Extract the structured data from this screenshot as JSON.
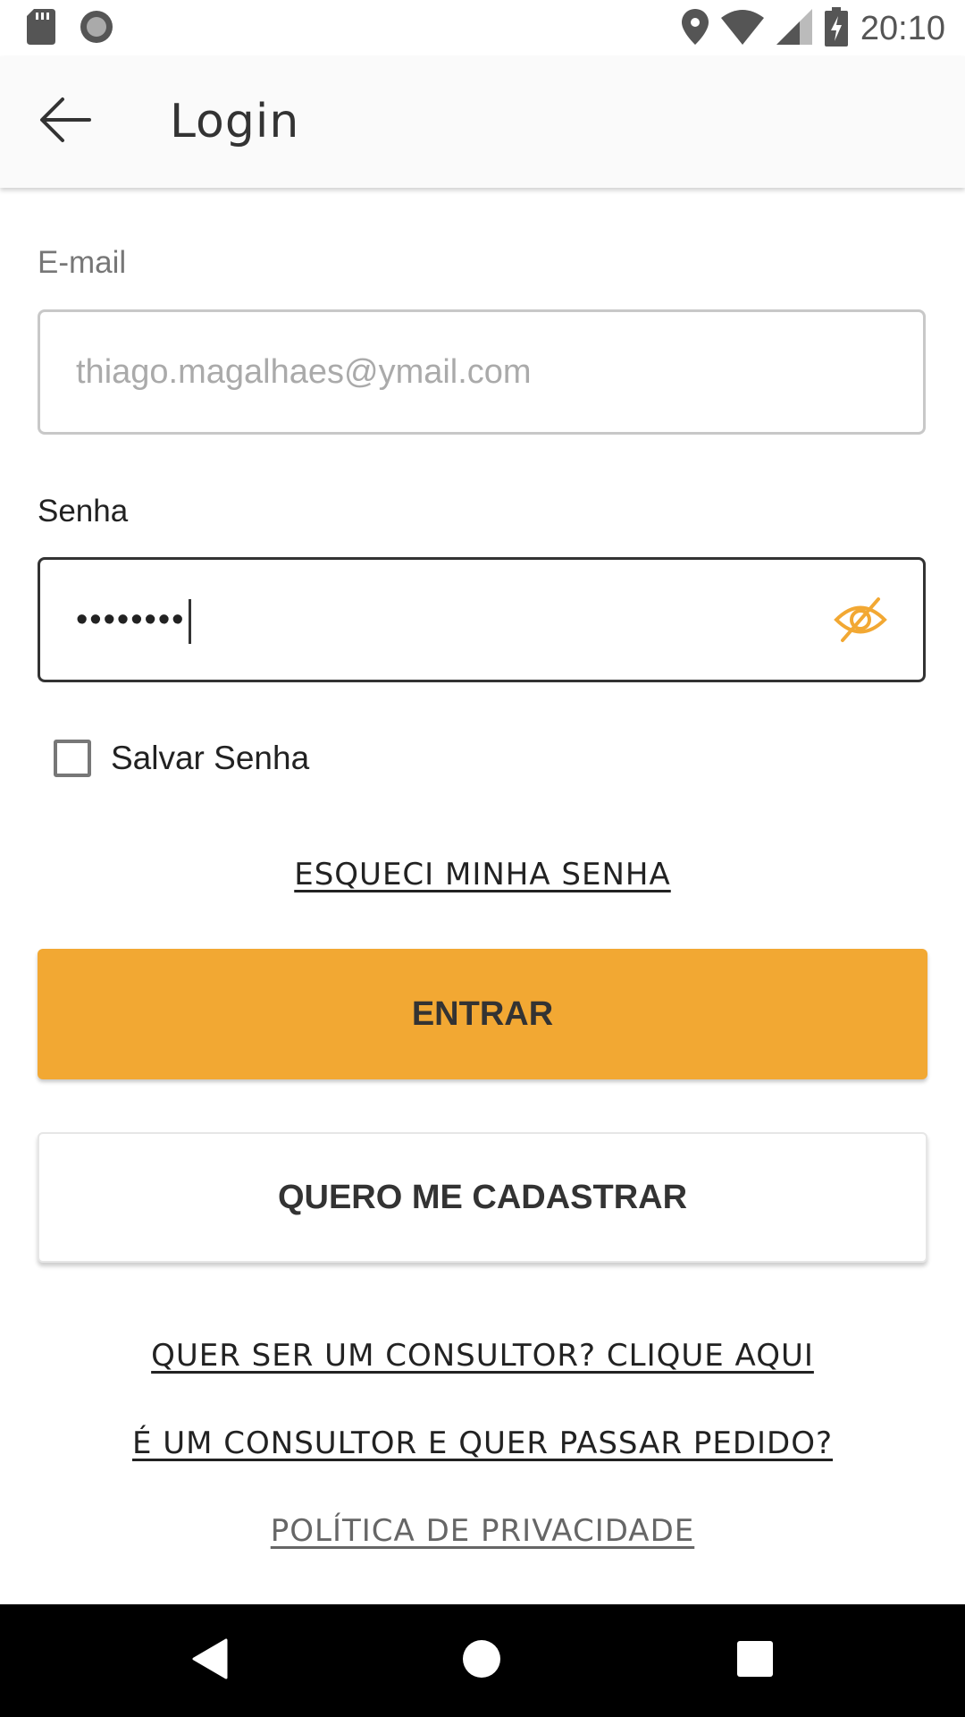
{
  "status_bar": {
    "time": "20:10",
    "icons": [
      "sd-card-icon",
      "sync-icon",
      "location-icon",
      "wifi-icon",
      "signal-icon",
      "battery-charging-icon"
    ]
  },
  "app_bar": {
    "title": "Login"
  },
  "form": {
    "email_label": "E-mail",
    "email_placeholder": "thiago.magalhaes@ymail.com",
    "password_label": "Senha",
    "password_value": "••••••••",
    "save_password_label": "Salvar Senha",
    "save_password_checked": false
  },
  "links": {
    "forgot_password": "ESQUECI MINHA SENHA",
    "become_consultant": "QUER SER UM CONSULTOR? CLIQUE AQUI",
    "consultant_order": "É UM CONSULTOR E QUER PASSAR PEDIDO?",
    "privacy_policy": "POLÍTICA DE PRIVACIDADE"
  },
  "buttons": {
    "login": "ENTRAR",
    "register": "QUERO ME CADASTRAR"
  },
  "colors": {
    "accent": "#f2a833",
    "text_dark": "#333333",
    "nav_bar": "#000000"
  }
}
